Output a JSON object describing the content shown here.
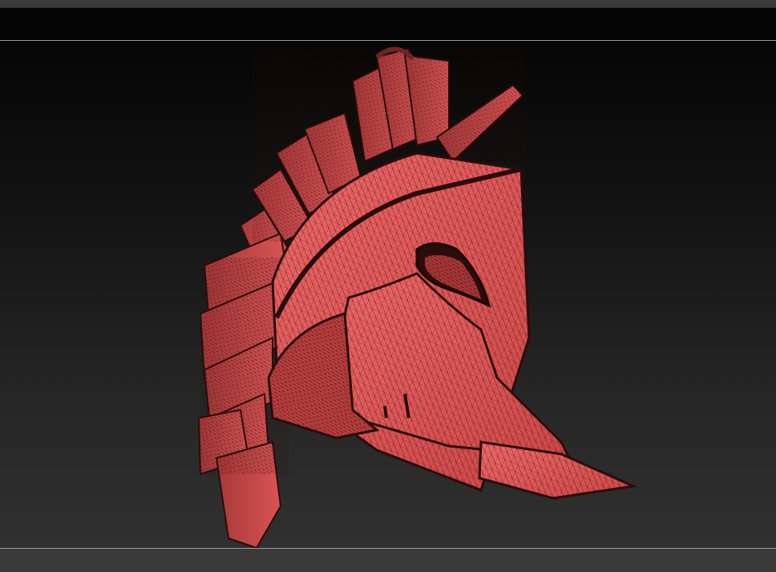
{
  "app": {
    "window": "3d-sculpt-viewport"
  },
  "viewport": {
    "subject": "helmet-mesh",
    "mesh_color": "#e85a5a",
    "wire_color": "#3a1212",
    "render_mode": "polyframe"
  },
  "colors": {
    "top_bar": "#3a3a3a",
    "toolbar_strip": "#050505",
    "viewport_top": "#050505",
    "viewport_bottom": "#303030",
    "frame_line": "#9a9a9a",
    "bottom_bar": "#3a3a3a"
  }
}
